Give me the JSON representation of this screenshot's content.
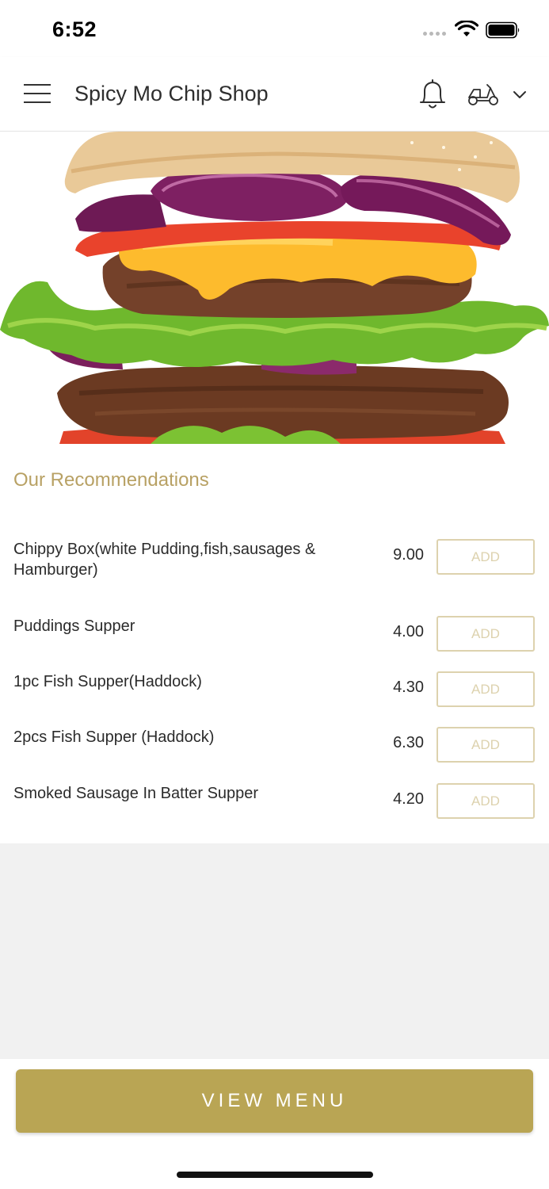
{
  "status_bar": {
    "time": "6:52"
  },
  "header": {
    "title": "Spicy Mo Chip Shop"
  },
  "recommendations": {
    "title": "Our Recommendations",
    "items": [
      {
        "name": "Chippy Box(white Pudding,fish,sausages & Hamburger)",
        "price": "9.00",
        "add_label": "ADD"
      },
      {
        "name": "Puddings Supper",
        "price": "4.00",
        "add_label": "ADD"
      },
      {
        "name": "1pc Fish Supper(Haddock)",
        "price": "4.30",
        "add_label": "ADD"
      },
      {
        "name": "2pcs Fish Supper (Haddock)",
        "price": "6.30",
        "add_label": "ADD"
      },
      {
        "name": "Smoked Sausage In Batter Supper",
        "price": "4.20",
        "add_label": "ADD"
      }
    ]
  },
  "footer": {
    "view_menu_label": "VIEW MENU"
  },
  "colors": {
    "accent": "#b9a554",
    "section_title": "#b8a164",
    "add_border": "#ddd2ae"
  }
}
